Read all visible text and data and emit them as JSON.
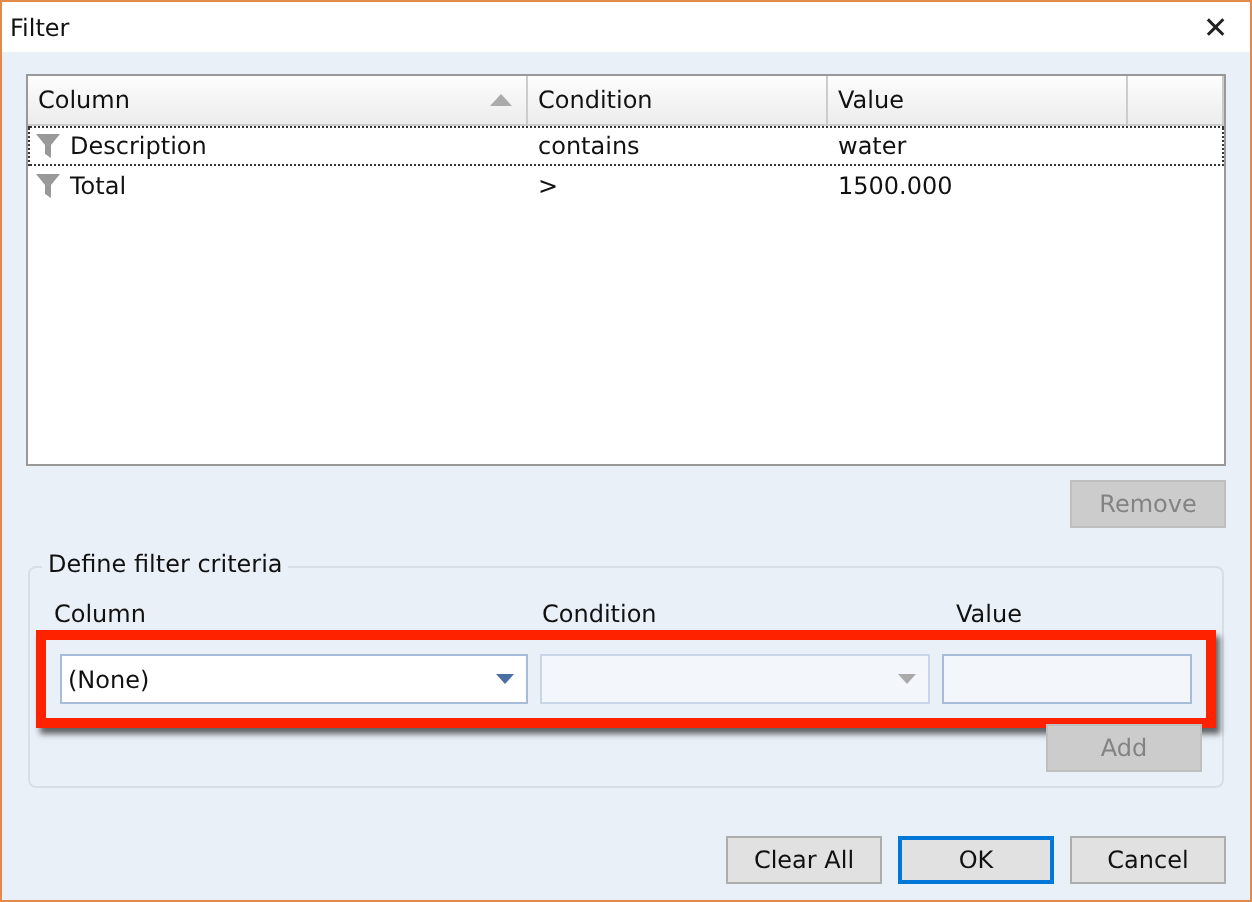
{
  "window": {
    "title": "Filter",
    "close": "✕"
  },
  "table": {
    "columns": [
      {
        "label": "Column",
        "sorted": true
      },
      {
        "label": "Condition",
        "sorted": false
      },
      {
        "label": "Value",
        "sorted": false
      }
    ],
    "rows": [
      {
        "column": "Description",
        "condition": "contains",
        "value": "water",
        "selected": true
      },
      {
        "column": "Total",
        "condition": ">",
        "value": "1500.000",
        "selected": false
      }
    ]
  },
  "remove_button": {
    "label": "Remove",
    "disabled": true
  },
  "criteria": {
    "title": "Define filter criteria",
    "column_label": "Column",
    "condition_label": "Condition",
    "value_label": "Value",
    "column_select": {
      "value": "(None)",
      "disabled": false
    },
    "condition_select": {
      "disabled": true
    },
    "value_field": {
      "disabled": false
    },
    "highlighted": true,
    "add_button": {
      "label": "Add",
      "disabled": true
    }
  },
  "buttons": [
    {
      "label": "Clear All",
      "default": false
    },
    {
      "label": "OK",
      "default": true
    },
    {
      "label": "Cancel",
      "default": false
    }
  ]
}
